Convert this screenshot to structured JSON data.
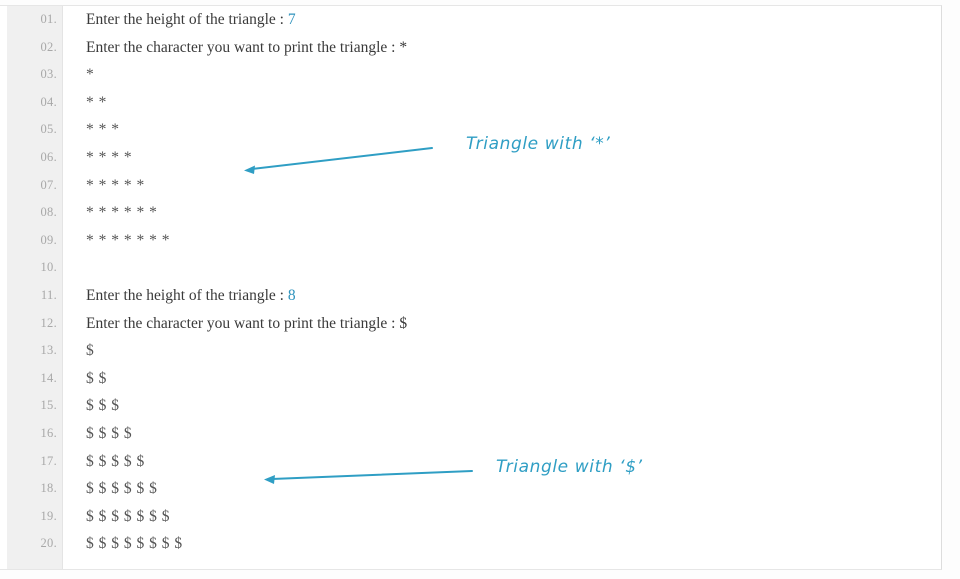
{
  "theme": {
    "accent_color": "#2f93bd",
    "annotation_color": "#2f9ec4",
    "gutter_background": "#f0f0f0",
    "line_number_color": "#a8a8a8",
    "code_text_color": "#3a3a3a"
  },
  "console": {
    "lines": [
      {
        "number": "01",
        "kind": "prompt",
        "prefix": "Enter the height of the triangle : ",
        "value": "7"
      },
      {
        "number": "02",
        "kind": "prompt",
        "prefix": "Enter the character you want to print the triangle : ",
        "value": "*",
        "value_plain": true
      },
      {
        "number": "03",
        "kind": "glyphs",
        "text": "*"
      },
      {
        "number": "04",
        "kind": "glyphs",
        "text": "* *"
      },
      {
        "number": "05",
        "kind": "glyphs",
        "text": "* * *"
      },
      {
        "number": "06",
        "kind": "glyphs",
        "text": "* * * *"
      },
      {
        "number": "07",
        "kind": "glyphs",
        "text": "* * * * *"
      },
      {
        "number": "08",
        "kind": "glyphs",
        "text": "* * * * * *"
      },
      {
        "number": "09",
        "kind": "glyphs",
        "text": "* * * * * * *"
      },
      {
        "number": "10",
        "kind": "blank",
        "text": ""
      },
      {
        "number": "11",
        "kind": "prompt",
        "prefix": "Enter the height of the triangle : ",
        "value": "8"
      },
      {
        "number": "12",
        "kind": "prompt",
        "prefix": "Enter the character you want to print the triangle : ",
        "value": "$",
        "value_plain": true
      },
      {
        "number": "13",
        "kind": "glyphs",
        "text": "$"
      },
      {
        "number": "14",
        "kind": "glyphs",
        "text": "$ $"
      },
      {
        "number": "15",
        "kind": "glyphs",
        "text": "$ $ $"
      },
      {
        "number": "16",
        "kind": "glyphs",
        "text": "$ $ $ $"
      },
      {
        "number": "17",
        "kind": "glyphs",
        "text": "$ $ $ $ $"
      },
      {
        "number": "18",
        "kind": "glyphs",
        "text": "$ $ $ $ $ $"
      },
      {
        "number": "19",
        "kind": "glyphs",
        "text": "$ $ $ $ $ $ $"
      },
      {
        "number": "20",
        "kind": "glyphs",
        "text": "$ $ $ $ $ $ $ $"
      }
    ]
  },
  "annotations": {
    "star": {
      "label": "Triangle with ‘*’"
    },
    "dollar": {
      "label": "Triangle with ‘$’"
    }
  }
}
